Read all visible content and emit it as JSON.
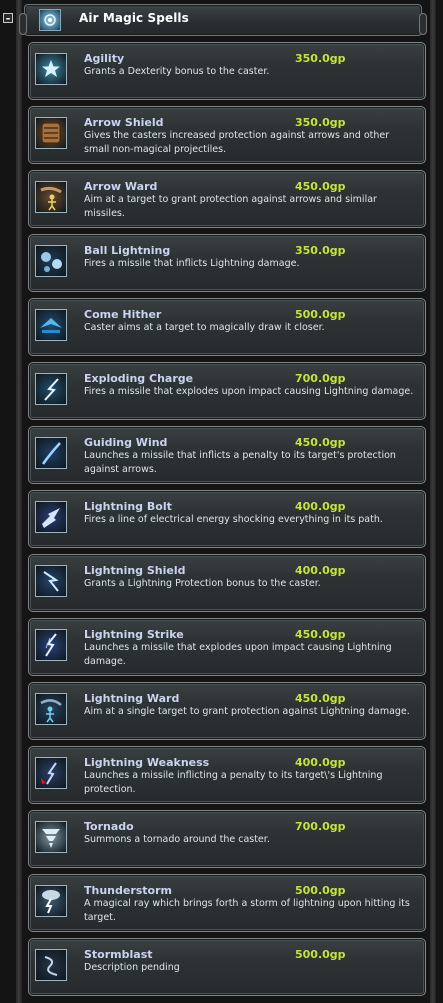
{
  "header": {
    "title": "Air Magic Spells",
    "collapse_symbol": "-",
    "icon": "air-magic-icon"
  },
  "spells": [
    {
      "name": "Agility",
      "price": "350.0gp",
      "description": "Grants a Dexterity bonus to the caster.",
      "icon": "agility-star-icon",
      "icon_color": "#3f8aa8"
    },
    {
      "name": "Arrow Shield",
      "price": "350.0gp",
      "description": "Gives the casters increased protection against arrows and other small non-magical projectiles.",
      "icon": "arrow-shield-icon",
      "icon_color": "#7a4f2a"
    },
    {
      "name": "Arrow Ward",
      "price": "450.0gp",
      "description": "Aim at a target to grant protection against arrows and similar missiles.",
      "icon": "arrow-ward-icon",
      "icon_color": "#6b4a2a"
    },
    {
      "name": "Ball Lightning",
      "price": "350.0gp",
      "description": "Fires a missile that inflicts Lightning damage.",
      "icon": "ball-lightning-icon",
      "icon_color": "#1f3d57"
    },
    {
      "name": "Come Hither",
      "price": "500.0gp",
      "description": "Caster aims at a target to magically draw it closer.",
      "icon": "come-hither-icon",
      "icon_color": "#1d4e74"
    },
    {
      "name": "Exploding Charge",
      "price": "700.0gp",
      "description": "Fires a missile that explodes upon impact causing Lightning damage.",
      "icon": "exploding-charge-icon",
      "icon_color": "#224e6c"
    },
    {
      "name": "Guiding Wind",
      "price": "450.0gp",
      "description": "Launches a missile that inflicts a penalty to its target's protection against arrows.",
      "icon": "guiding-wind-icon",
      "icon_color": "#1e3f66"
    },
    {
      "name": "Lightning Bolt",
      "price": "400.0gp",
      "description": "Fires a line of electrical energy shocking everything in its path.",
      "icon": "lightning-bolt-icon",
      "icon_color": "#2a3c73"
    },
    {
      "name": "Lightning Shield",
      "price": "400.0gp",
      "description": "Grants a Lightning Protection bonus to the caster.",
      "icon": "lightning-shield-icon",
      "icon_color": "#24456d"
    },
    {
      "name": "Lightning Strike",
      "price": "450.0gp",
      "description": "Launches a missile that explodes upon impact causing Lightning damage.",
      "icon": "lightning-strike-icon",
      "icon_color": "#28427a"
    },
    {
      "name": "Lightning Ward",
      "price": "450.0gp",
      "description": "Aim at a single target to grant protection against Lightning damage.",
      "icon": "lightning-ward-icon",
      "icon_color": "#27425f"
    },
    {
      "name": "Lightning Weakness",
      "price": "400.0gp",
      "description": "Launches a missile inflicting a penalty to its target\\'s Lightning protection.",
      "icon": "lightning-weakness-icon",
      "icon_color": "#2b3f66"
    },
    {
      "name": "Tornado",
      "price": "700.0gp",
      "description": "Summons a tornado around the caster.",
      "icon": "tornado-icon",
      "icon_color": "#7d96a2"
    },
    {
      "name": "Thunderstorm",
      "price": "500.0gp",
      "description": "A magical ray which brings forth a storm of lightning upon hitting its target.",
      "icon": "thunderstorm-icon",
      "icon_color": "#3b5870"
    },
    {
      "name": "Stormblast",
      "price": "500.0gp",
      "description": "Description pending",
      "icon": "stormblast-icon",
      "icon_color": "#263447"
    }
  ]
}
